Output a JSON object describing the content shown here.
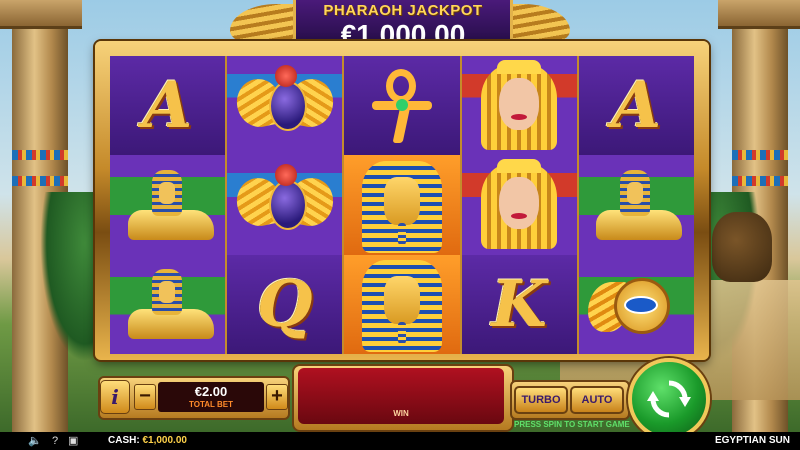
{
  "jackpot": {
    "title": "PHARAOH JACKPOT",
    "amount": "€1,000.00"
  },
  "reels": [
    [
      {
        "symbol": "A",
        "bg": "purple"
      },
      {
        "symbol": "sphinx",
        "bg": "green"
      },
      {
        "symbol": "sphinx",
        "bg": "green"
      }
    ],
    [
      {
        "symbol": "scarab",
        "bg": "blue"
      },
      {
        "symbol": "scarab",
        "bg": "blue"
      },
      {
        "symbol": "Q",
        "bg": "purple"
      }
    ],
    [
      {
        "symbol": "ankh",
        "bg": "purple"
      },
      {
        "symbol": "pharaoh",
        "bg": "orange"
      },
      {
        "symbol": "pharaoh",
        "bg": "orange"
      }
    ],
    [
      {
        "symbol": "queen",
        "bg": "red"
      },
      {
        "symbol": "queen",
        "bg": "red"
      },
      {
        "symbol": "K",
        "bg": "purple"
      }
    ],
    [
      {
        "symbol": "A",
        "bg": "purple"
      },
      {
        "symbol": "sphinx",
        "bg": "green"
      },
      {
        "symbol": "eye-of-ra",
        "bg": "green"
      }
    ]
  ],
  "controls": {
    "info_label": "i",
    "minus_label": "−",
    "plus_label": "+",
    "bet_value": "€2.00",
    "bet_label": "TOTAL BET",
    "win_label": "WIN",
    "turbo_label": "TURBO",
    "auto_label": "AUTO",
    "hint": "PRESS SPIN TO START GAME",
    "spin_icon": "refresh-arrows-icon"
  },
  "statusbar": {
    "cash_label": "CASH:",
    "cash_value": "€1,000.00",
    "game_name": "EGYPTIAN SUN",
    "icons": [
      "speaker-icon",
      "help-icon",
      "fullscreen-icon"
    ]
  },
  "colors": {
    "spin_green": "#1a9a2a",
    "gold": "#f0c85a",
    "reel_purple": "#4a1f8e"
  }
}
